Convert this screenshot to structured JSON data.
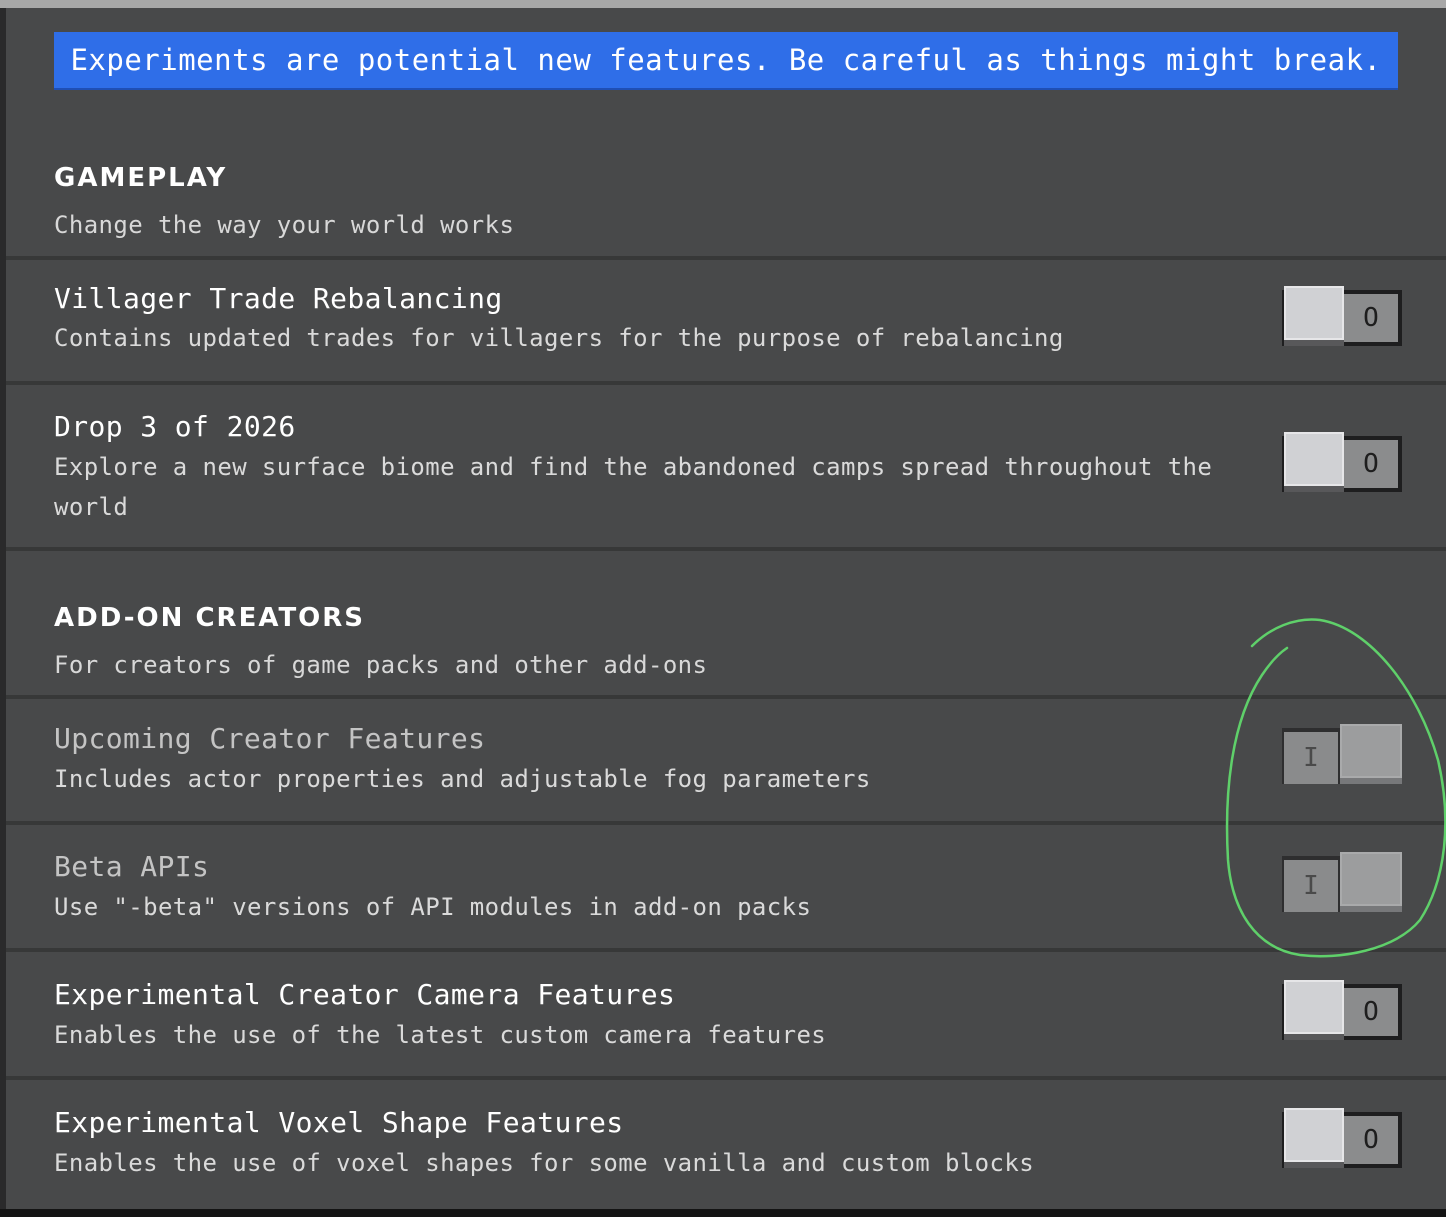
{
  "banner": {
    "text": "Experiments are potential new features. Be careful as things might break."
  },
  "sections": [
    {
      "title": "GAMEPLAY",
      "description": "Change the way your world works",
      "items": [
        {
          "title": "Villager Trade Rebalancing",
          "description": "Contains updated trades for villagers for the purpose of rebalancing",
          "toggle": {
            "state": "off",
            "glyph": "O"
          }
        },
        {
          "title": "Drop 3 of 2026",
          "description": "Explore a new surface biome and find the abandoned camps spread throughout the world",
          "toggle": {
            "state": "off",
            "glyph": "O"
          }
        }
      ]
    },
    {
      "title": "ADD-ON CREATORS",
      "description": "For creators of game packs and other add-ons",
      "items": [
        {
          "title": "Upcoming Creator Features",
          "description": "Includes actor properties and adjustable fog parameters",
          "toggle": {
            "state": "on",
            "disabled": true,
            "glyph": "I"
          }
        },
        {
          "title": "Beta APIs",
          "description": "Use \"-beta\" versions of API modules in add-on packs",
          "toggle": {
            "state": "on",
            "disabled": true,
            "glyph": "I"
          }
        },
        {
          "title": "Experimental Creator Camera Features",
          "description": "Enables the use of the latest custom camera features",
          "toggle": {
            "state": "off",
            "glyph": "O"
          }
        },
        {
          "title": "Experimental Voxel Shape Features",
          "description": "Enables the use of voxel shapes for some vanilla and custom blocks",
          "toggle": {
            "state": "off",
            "glyph": "O"
          }
        }
      ]
    }
  ],
  "colors": {
    "banner": "#2f6ee8",
    "panel": "#48494a",
    "annotation_circle": "#5fd06a"
  },
  "annotation": {
    "shape": "hand-drawn-circle",
    "target": "add-on creator toggles"
  }
}
